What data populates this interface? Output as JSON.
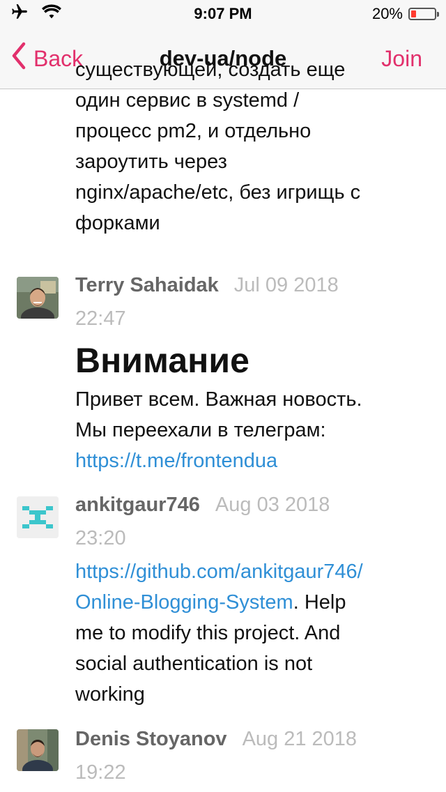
{
  "status_bar": {
    "time": "9:07 PM",
    "battery": "20%",
    "battery_color": "#ff3b30"
  },
  "nav": {
    "back_label": "Back",
    "title": "dev-ua/node",
    "join_label": "Join",
    "accent_color": "#e2306c"
  },
  "messages": {
    "continued": {
      "lines": [
        "существующей, создать еще",
        "один сервис в systemd /",
        "процесс pm2, и отдельно",
        "зароутить через",
        "nginx/apache/etc, без игрищь с",
        "форками"
      ]
    },
    "m1": {
      "author": "Terry Sahaidak",
      "date": "Jul 09 2018",
      "time": "22:47",
      "heading": "Внимание",
      "line1": "Привет всем. Важная новость.",
      "line2": "Мы переехали в телеграм:",
      "link": "https://t.me/frontendua"
    },
    "m2": {
      "author": "ankitgaur746",
      "date": "Aug 03 2018",
      "time": "23:20",
      "link_line1": "https://github.com/ankitgaur746/",
      "link_line2": "Online-Blogging-System",
      "text_after_link": ". Help",
      "line3": "me to modify this project. And",
      "line4": "social authentication is not",
      "line5": "working"
    },
    "m3": {
      "author": "Denis Stoyanov",
      "date": "Aug 21 2018",
      "time": "19:22"
    }
  },
  "icons": {
    "airplane": "airplane-icon",
    "wifi": "wifi-icon",
    "battery": "battery-icon",
    "back_chevron": "chevron-left-icon"
  }
}
